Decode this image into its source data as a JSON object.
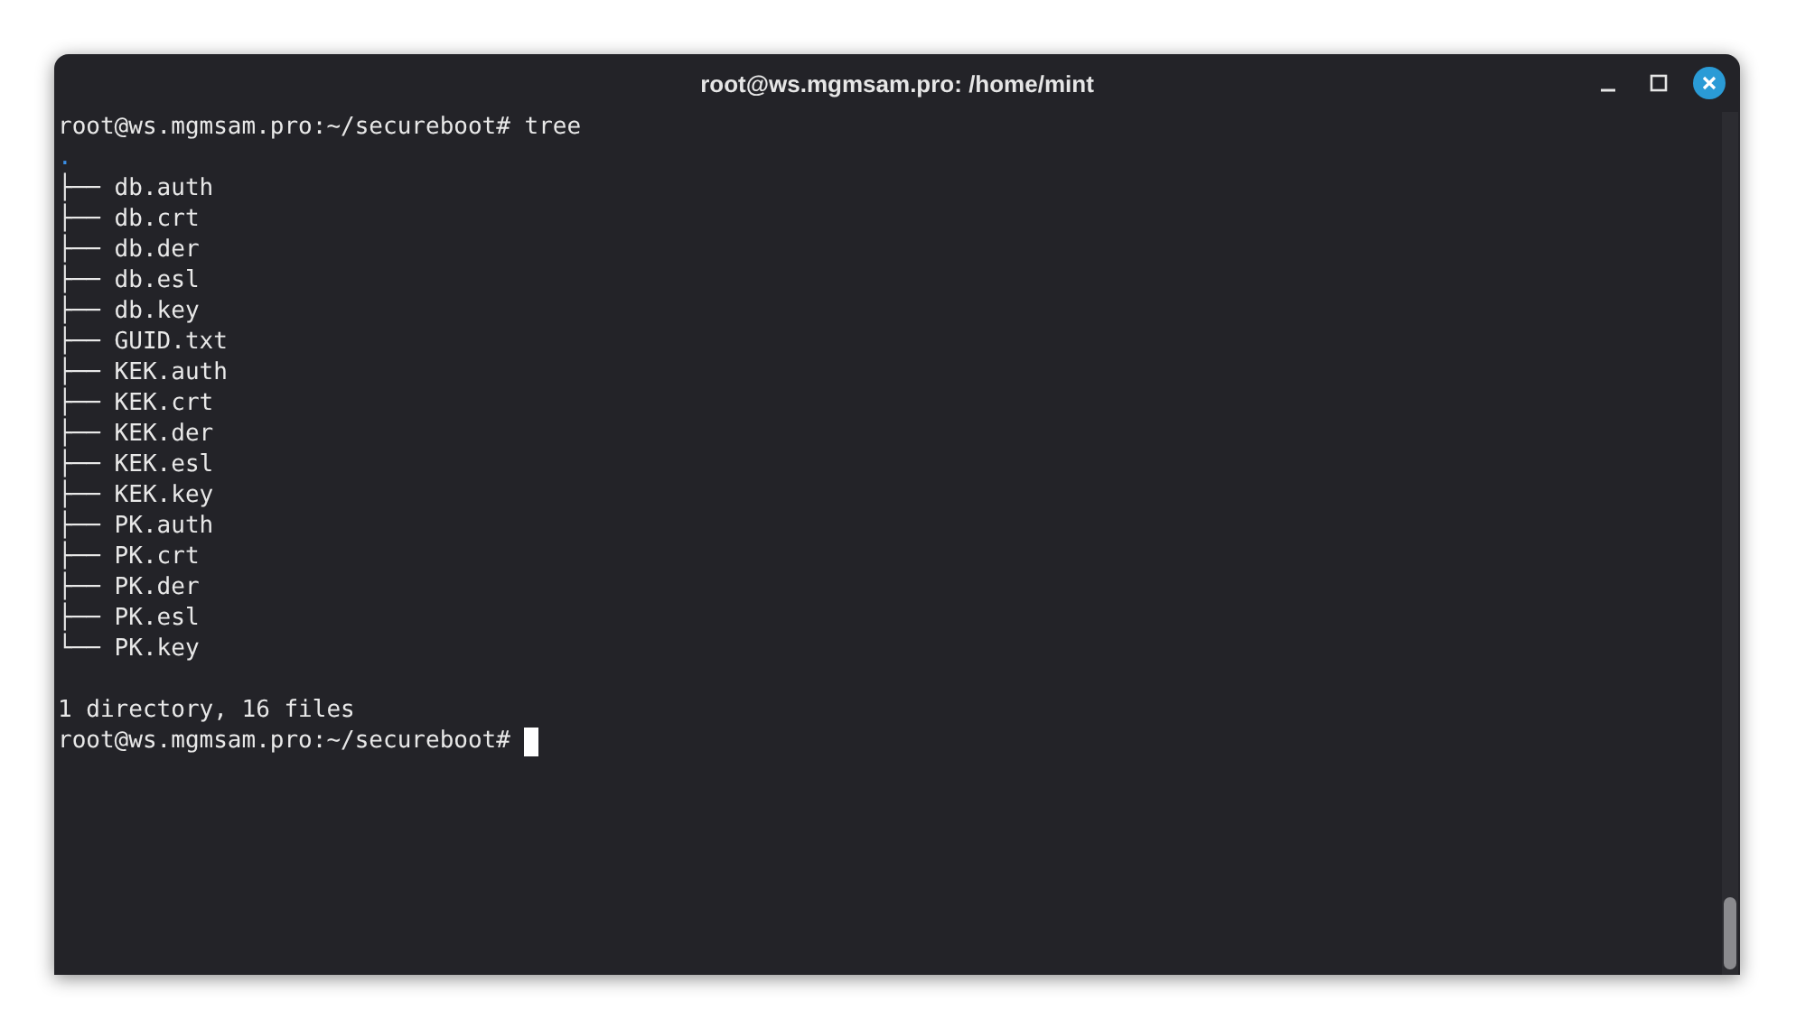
{
  "window": {
    "title": "root@ws.mgmsam.pro: /home/mint"
  },
  "terminal": {
    "lines": [
      {
        "kind": "prompt",
        "text": "root@ws.mgmsam.pro:~/secureboot# tree"
      },
      {
        "kind": "directory",
        "text": "."
      },
      {
        "kind": "output",
        "text": "├── db.auth"
      },
      {
        "kind": "output",
        "text": "├── db.crt"
      },
      {
        "kind": "output",
        "text": "├── db.der"
      },
      {
        "kind": "output",
        "text": "├── db.esl"
      },
      {
        "kind": "output",
        "text": "├── db.key"
      },
      {
        "kind": "output",
        "text": "├── GUID.txt"
      },
      {
        "kind": "output",
        "text": "├── KEK.auth"
      },
      {
        "kind": "output",
        "text": "├── KEK.crt"
      },
      {
        "kind": "output",
        "text": "├── KEK.der"
      },
      {
        "kind": "output",
        "text": "├── KEK.esl"
      },
      {
        "kind": "output",
        "text": "├── KEK.key"
      },
      {
        "kind": "output",
        "text": "├── PK.auth"
      },
      {
        "kind": "output",
        "text": "├── PK.crt"
      },
      {
        "kind": "output",
        "text": "├── PK.der"
      },
      {
        "kind": "output",
        "text": "├── PK.esl"
      },
      {
        "kind": "output",
        "text": "└── PK.key"
      },
      {
        "kind": "blank"
      },
      {
        "kind": "output",
        "text": "1 directory, 16 files"
      },
      {
        "kind": "prompt_cursor",
        "text": "root@ws.mgmsam.pro:~/secureboot#"
      }
    ]
  }
}
